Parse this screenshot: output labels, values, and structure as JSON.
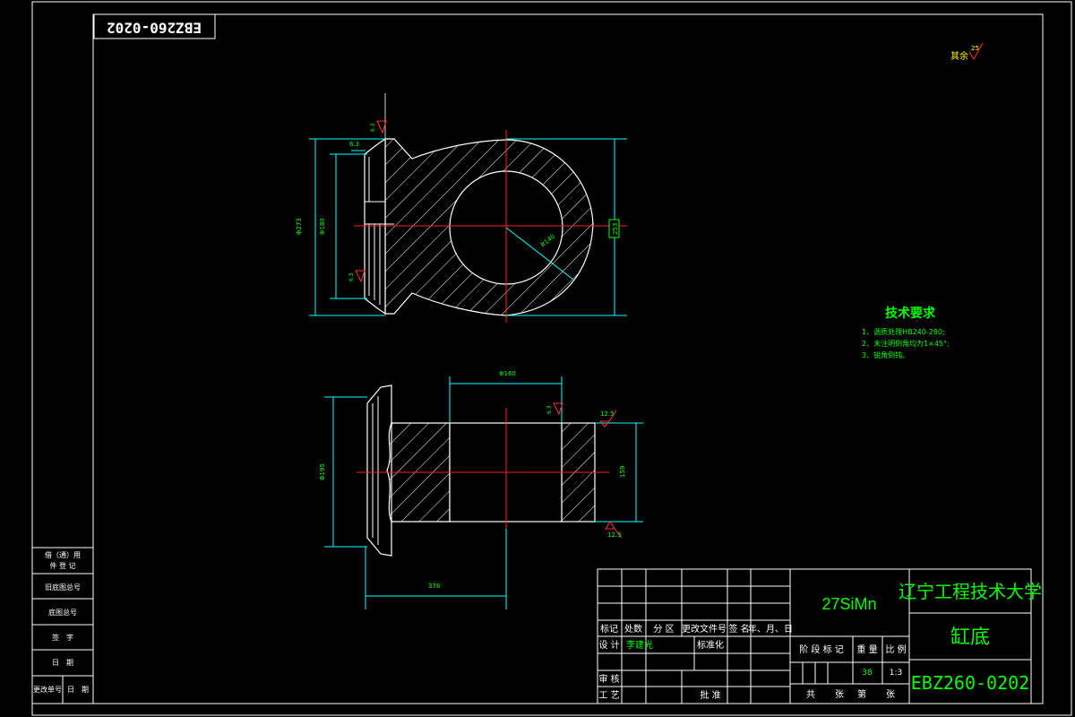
{
  "drawing_number_rotated": "EBZ260-0202",
  "surface_finish_note": {
    "label": "其余",
    "value": "25"
  },
  "top_view": {
    "dims": {
      "left_outer": "Φ273",
      "left_inner": "Φ180",
      "right_height": "253",
      "radius": "R140",
      "gap": "6.3"
    },
    "roughness": [
      "6.3",
      "6.3"
    ]
  },
  "bottom_view": {
    "dims": {
      "top_width": "Φ160",
      "right_height": "159",
      "left_height": "Φ195",
      "bottom_width": "378"
    },
    "roughness": [
      "12.5",
      "6.3",
      "12.5"
    ]
  },
  "tech_requirements": {
    "title": "技术要求",
    "items": [
      "1、调质处理HB240-280;",
      "2、未注明倒角均为1×45°;",
      "3、锐角倒钝。"
    ]
  },
  "left_strip": {
    "cells": [
      "借（通）用",
      "件 登 记",
      "旧底图总号",
      "底图总号",
      "签　字",
      "日　期",
      "更改单号",
      "日　期"
    ]
  },
  "title_block": {
    "material": "27SiMn",
    "university": "辽宁工程技术大学",
    "part_name": "缸底",
    "drawing_number": "EBZ260-0202",
    "header_row": [
      "标记",
      "处数",
      "分 区",
      "更改文件号",
      "签 名",
      "年、月、日"
    ],
    "design_label": "设 计",
    "designer": "李建光",
    "standardization": "标准化",
    "review_label": "审 核",
    "process_label": "工 艺",
    "approve_label": "批 准",
    "stage_label": "阶 段 标 记",
    "weight_label": "重 量",
    "scale_label": "比 例",
    "weight": "38",
    "scale": "1:3",
    "sheet_row": [
      "共",
      "张",
      "第",
      "张"
    ]
  }
}
